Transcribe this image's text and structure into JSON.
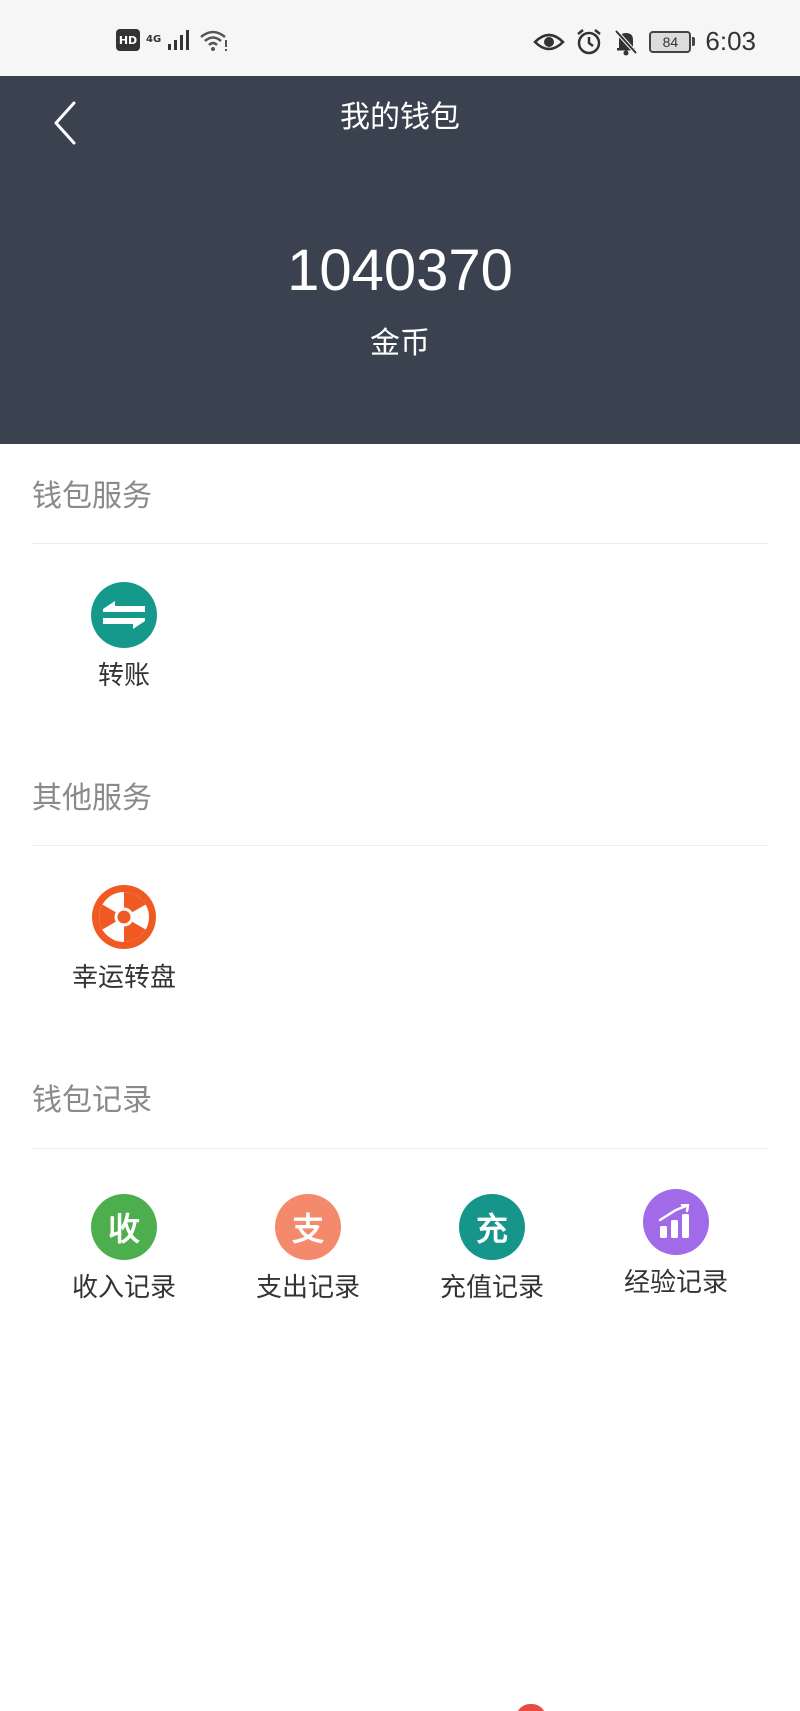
{
  "status_bar": {
    "network_badge": "HD",
    "network_type": "4G",
    "battery_level": "84",
    "time": "6:03",
    "icons": [
      "hd-icon",
      "signal-icon",
      "wifi-icon",
      "eye-icon",
      "alarm-icon",
      "notification-off-icon",
      "battery-icon"
    ]
  },
  "header": {
    "title": "我的钱包",
    "balance": "1040370",
    "balance_unit": "金币",
    "background_color": "#3a4250"
  },
  "sections": [
    {
      "title": "钱包服务",
      "items": [
        {
          "label": "转账",
          "icon": "transfer-icon",
          "color": "#14998a"
        }
      ]
    },
    {
      "title": "其他服务",
      "items": [
        {
          "label": "幸运转盘",
          "icon": "lucky-wheel-icon",
          "color": "#f05a22"
        }
      ]
    },
    {
      "title": "钱包记录",
      "items": [
        {
          "label": "收入记录",
          "icon_text": "收",
          "icon": "income-icon",
          "color": "#4cae4c"
        },
        {
          "label": "支出记录",
          "icon_text": "支",
          "icon": "expense-icon",
          "color": "#f4896b"
        },
        {
          "label": "充值记录",
          "icon_text": "充",
          "icon": "recharge-icon",
          "color": "#16968a"
        },
        {
          "label": "经验记录",
          "icon": "experience-chart-icon",
          "color": "#a06ae8"
        }
      ]
    }
  ]
}
